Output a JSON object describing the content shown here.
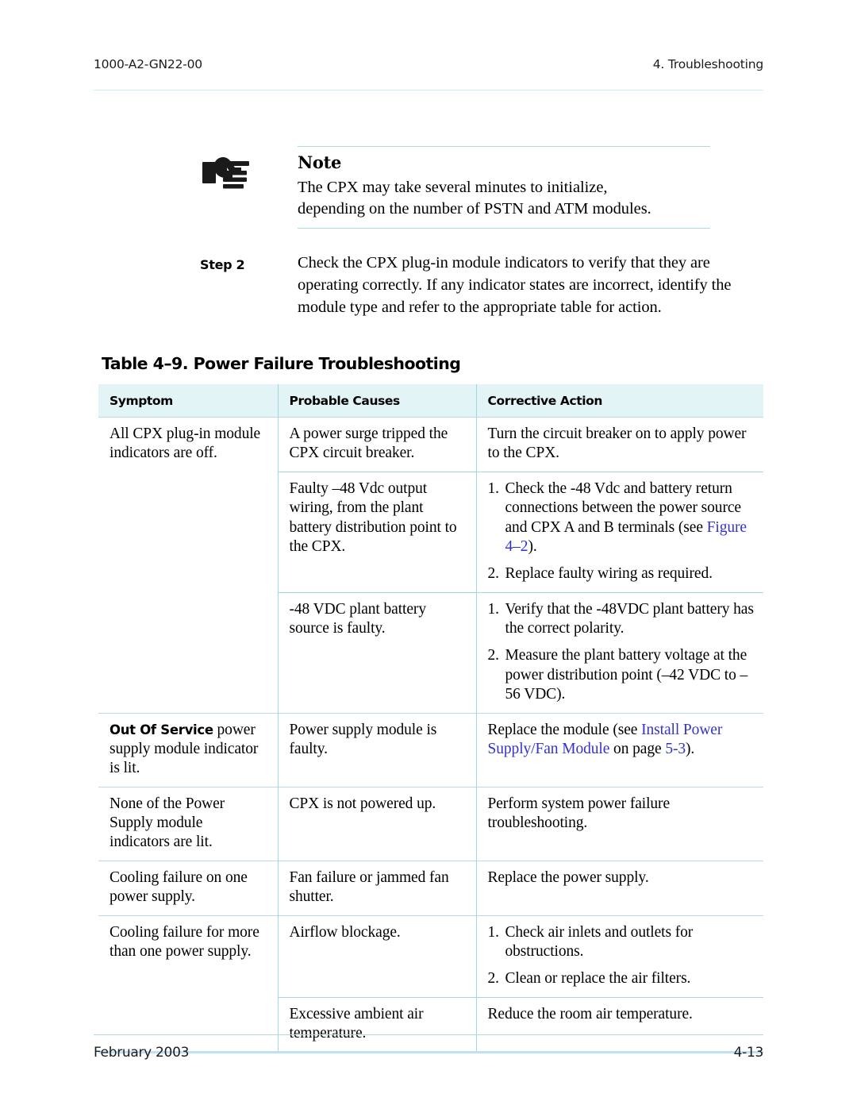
{
  "header": {
    "doc_number": "1000-A2-GN22-00",
    "section": "4. Troubleshooting"
  },
  "note": {
    "icon": "pointing-hand-icon",
    "title": "Note",
    "line1": "The CPX may take several minutes to initialize,",
    "line2": "depending on the number of PSTN and ATM modules."
  },
  "step": {
    "label": "Step  2",
    "text": "Check the CPX plug-in module indicators to verify that they are operating correctly. If any indicator states are incorrect, identify the module type and refer to the appropriate table for action."
  },
  "table": {
    "caption": "Table 4–9. Power Failure Troubleshooting",
    "columns": [
      "Symptom",
      "Probable Causes",
      "Corrective Action"
    ],
    "rows": [
      {
        "symptom": "All CPX plug-in module indicators are off.",
        "subrows": [
          {
            "cause": "A power surge tripped the CPX circuit breaker.",
            "action": "Turn the circuit breaker on to apply power to the CPX."
          },
          {
            "cause": "Faulty –48 Vdc output wiring, from the plant battery distribution point to the CPX.",
            "action_items": [
              {
                "num": "1.",
                "pre": "Check the -48 Vdc and battery return connections between the power source and CPX A and B terminals (see ",
                "link": "Figure 4–2",
                "post": ")."
              },
              {
                "num": "2.",
                "pre": "Replace faulty wiring as required.",
                "link": "",
                "post": ""
              }
            ]
          },
          {
            "cause": "-48 VDC plant battery source is faulty.",
            "action_items": [
              {
                "num": "1.",
                "pre": "Verify that the -48VDC plant battery has the correct polarity.",
                "link": "",
                "post": ""
              },
              {
                "num": "2.",
                "pre": "Measure the plant battery voltage at the power distribution point (–42 VDC to –56 VDC).",
                "link": "",
                "post": ""
              }
            ]
          }
        ]
      },
      {
        "symptom_bold": "Out Of Service",
        "symptom_rest": " power supply module indicator is lit.",
        "subrows": [
          {
            "cause": "Power supply module is faulty.",
            "action_pre": "Replace the module (see ",
            "action_link1": "Install Power Supply/Fan Module",
            "action_mid": " on page ",
            "action_link2": "5-3",
            "action_post": ")."
          }
        ]
      },
      {
        "symptom": "None of the Power Supply module indicators are lit.",
        "subrows": [
          {
            "cause": "CPX is not powered up.",
            "action": "Perform system power failure troubleshooting."
          }
        ]
      },
      {
        "symptom": "Cooling failure on one power supply.",
        "subrows": [
          {
            "cause": "Fan failure or jammed fan shutter.",
            "action": "Replace the power supply."
          }
        ]
      },
      {
        "symptom": "Cooling failure for more than one power supply.",
        "subrows": [
          {
            "cause": "Airflow blockage.",
            "action_items": [
              {
                "num": "1.",
                "pre": "Check air inlets and outlets for obstructions.",
                "link": "",
                "post": ""
              },
              {
                "num": "2.",
                "pre": "Clean or replace the air filters.",
                "link": "",
                "post": ""
              }
            ]
          },
          {
            "cause": "Excessive ambient air temperature.",
            "action": "Reduce the room air temperature."
          }
        ]
      }
    ]
  },
  "footer": {
    "date": "February 2003",
    "page": "4-13"
  },
  "colors": {
    "link": "#3333cc",
    "header_fill": "#e2f4f6",
    "rule": "#aedbdd",
    "cell_border": "#9fd8dd",
    "major_border": "#b9d9ef",
    "table_bottom": "#bfe1f5"
  }
}
